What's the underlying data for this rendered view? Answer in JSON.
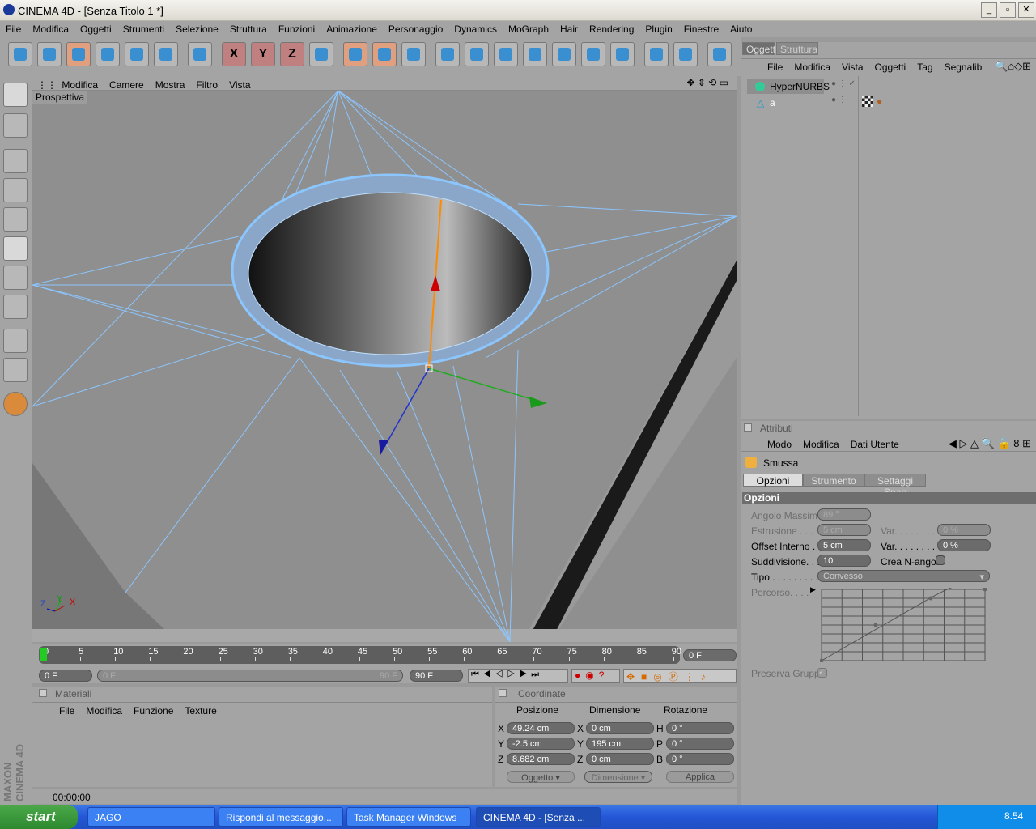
{
  "window": {
    "title": "CINEMA 4D - [Senza Titolo 1 *]"
  },
  "menu": [
    "File",
    "Modifica",
    "Oggetti",
    "Strumenti",
    "Selezione",
    "Struttura",
    "Funzioni",
    "Animazione",
    "Personaggio",
    "Dynamics",
    "MoGraph",
    "Hair",
    "Rendering",
    "Plugin",
    "Finestre",
    "Aiuto"
  ],
  "toolbar": [
    "undo-icon",
    "redo-icon",
    "select-icon",
    "move-icon",
    "scale-icon",
    "rotate-icon",
    "object-mode-icon",
    "x-axis-icon",
    "y-axis-icon",
    "z-axis-icon",
    "coordinate-system-icon",
    "render-view-icon",
    "render-picture-viewer-icon",
    "render-settings-icon",
    "cube-icon",
    "spline-icon",
    "nurbs-icon",
    "array-icon",
    "deformer-icon",
    "scene-icon",
    "particles-icon",
    "help-icon",
    "render-region-icon",
    "web-icon"
  ],
  "toolbar_labels": {
    "x": "X",
    "y": "Y",
    "z": "Z"
  },
  "viewport": {
    "menu": [
      "Modifica",
      "Camere",
      "Mostra",
      "Filtro",
      "Vista"
    ],
    "label": "Prospettiva",
    "axes": {
      "x": "X",
      "y": "Y",
      "z": "Z"
    }
  },
  "timeline": {
    "ticks": [
      "0",
      "5",
      "10",
      "15",
      "20",
      "25",
      "30",
      "35",
      "40",
      "45",
      "50",
      "55",
      "60",
      "65",
      "70",
      "75",
      "80",
      "85",
      "90"
    ],
    "current_frame": "0 F",
    "start": "0 F",
    "range_start": "0 F",
    "range_end": "90 F",
    "end": "90 F"
  },
  "objects": {
    "tabs": [
      "Oggetti",
      "Struttura"
    ],
    "menu": [
      "File",
      "Modifica",
      "Vista",
      "Oggetti",
      "Tag",
      "Segnalib"
    ],
    "items": [
      {
        "name": "HyperNURBS"
      },
      {
        "name": "a"
      }
    ]
  },
  "attributes": {
    "title": "Attributi",
    "menu": [
      "Modo",
      "Modifica",
      "Dati Utente"
    ],
    "tool": "Smussa",
    "tabs": [
      "Opzioni",
      "Strumento",
      "Settaggi Snap"
    ],
    "section": "Opzioni",
    "fields": {
      "angolo_label": "Angolo Massimo",
      "angolo": "89 °",
      "estrusione_label": "Estrusione . . . .",
      "estrusione": "5 cm",
      "var1_label": "Var. . . . . . . .",
      "var1": "0 %",
      "offset_label": "Offset Interno . .",
      "offset": "5 cm",
      "var2_label": "Var. . . . . . . .",
      "var2": "0 %",
      "sudd_label": "Suddivisione. . .",
      "sudd": "10",
      "ngon_label": "Crea N-angoli",
      "tipo_label": "Tipo . . . . . . . . .",
      "tipo": "Convesso",
      "percorso_label": "Percorso. . . .",
      "preserva_label": "Preserva Gruppi"
    },
    "ngon_checked": false,
    "preserva_checked": true
  },
  "materials": {
    "title": "Materiali",
    "menu": [
      "File",
      "Modifica",
      "Funzione",
      "Texture"
    ]
  },
  "coordinates": {
    "title": "Coordinate",
    "headers": [
      "Posizione",
      "Dimensione",
      "Rotazione"
    ],
    "rows": [
      {
        "pl": "X",
        "p": "49.24 cm",
        "dl": "X",
        "d": "0 cm",
        "rl": "H",
        "r": "0 °"
      },
      {
        "pl": "Y",
        "p": "-2.5 cm",
        "dl": "Y",
        "d": "195 cm",
        "rl": "P",
        "r": "0 °"
      },
      {
        "pl": "Z",
        "p": "8.682 cm",
        "dl": "Z",
        "d": "0 cm",
        "rl": "B",
        "r": "0 °"
      }
    ],
    "mode": "Oggetto",
    "size_mode": "Dimensione",
    "apply": "Applica"
  },
  "status": {
    "time": "00:00:00"
  },
  "brand": "MAXON CINEMA 4D",
  "taskbar": {
    "start": "start",
    "tasks": [
      "JAGO",
      "Rispondi al messaggio...",
      "Task Manager Windows",
      "CINEMA 4D - [Senza ..."
    ],
    "clock": "8.54"
  }
}
